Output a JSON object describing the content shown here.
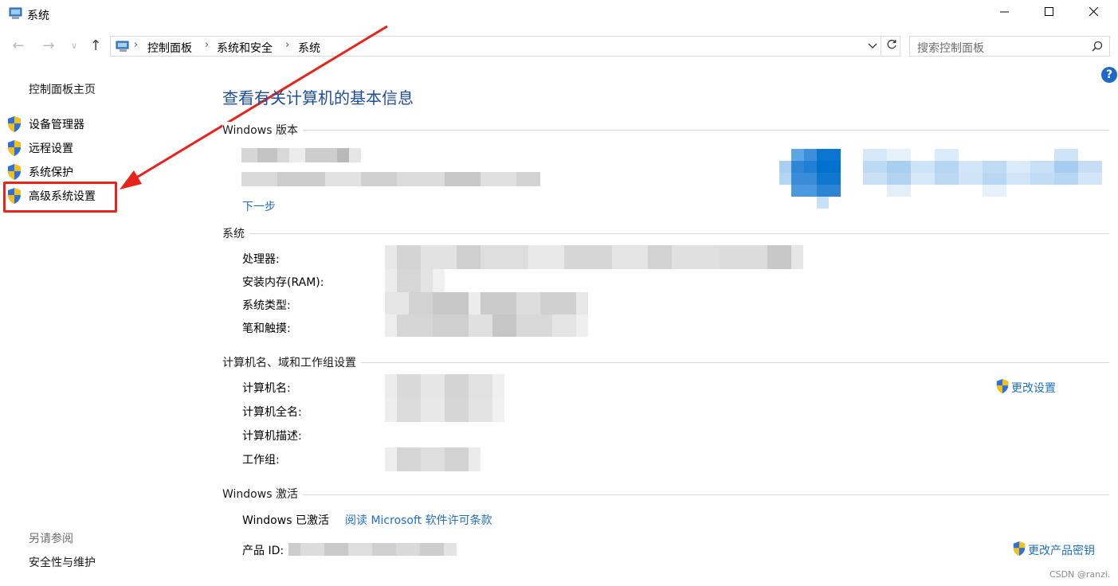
{
  "window": {
    "title": "系统",
    "minimize_icon": "minimize-icon",
    "maximize_icon": "maximize-icon",
    "close_icon": "close-icon"
  },
  "addressbar": {
    "breadcrumbs": [
      "控制面板",
      "系统和安全",
      "系统"
    ],
    "separator": "›"
  },
  "search": {
    "placeholder": "搜索控制面板"
  },
  "sidebar": {
    "home": "控制面板主页",
    "tasks": [
      {
        "label": "设备管理器",
        "icon": "shield-icon"
      },
      {
        "label": "远程设置",
        "icon": "shield-icon"
      },
      {
        "label": "系统保护",
        "icon": "shield-icon"
      },
      {
        "label": "高级系统设置",
        "icon": "shield-icon",
        "highlighted": true
      }
    ],
    "see_also_title": "另请参阅",
    "see_also_links": [
      "安全性与维护"
    ]
  },
  "main": {
    "title": "查看有关计算机的基本信息",
    "windows_edition": {
      "heading": "Windows 版本",
      "next_link": "下一步"
    },
    "system": {
      "heading": "系统",
      "labels": [
        "处理器:",
        "安装内存(RAM):",
        "系统类型:",
        "笔和触摸:"
      ]
    },
    "computer_name": {
      "heading": "计算机名、域和工作组设置",
      "labels": [
        "计算机名:",
        "计算机全名:",
        "计算机描述:",
        "工作组:"
      ],
      "change_settings": "更改设置"
    },
    "activation": {
      "heading": "Windows 激活",
      "status": "Windows 已激活",
      "license_link": "阅读 Microsoft 软件许可条款",
      "product_id_label": "产品 ID:",
      "change_key": "更改产品密钥"
    }
  },
  "watermark": "CSDN @ranzi.",
  "colors": {
    "link": "#1f6fbf",
    "title": "#1e4e9c",
    "annotation": "#e8231b",
    "windows_blue": "#0078d7"
  }
}
